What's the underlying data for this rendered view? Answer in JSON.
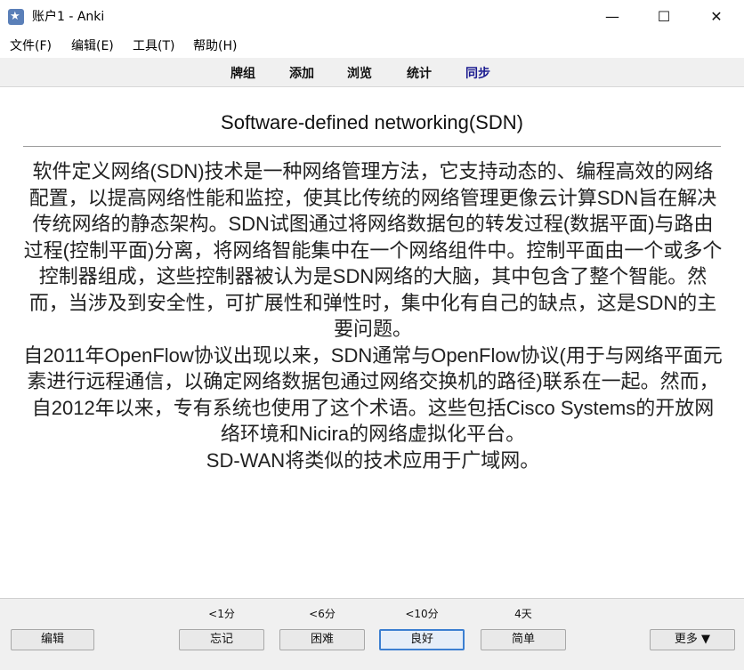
{
  "window": {
    "title": "账户1 - Anki",
    "minimize_glyph": "—",
    "maximize_glyph": "☐",
    "close_glyph": "✕",
    "icon": "anki-star-icon"
  },
  "menu": [
    {
      "label": "文件(F)"
    },
    {
      "label": "编辑(E)"
    },
    {
      "label": "工具(T)"
    },
    {
      "label": "帮助(H)"
    }
  ],
  "toolbar": {
    "decks": "牌组",
    "add": "添加",
    "browse": "浏览",
    "stats": "统计",
    "sync": "同步"
  },
  "card": {
    "title": "Software-defined networking(SDN)",
    "paragraph1": "软件定义网络(SDN)技术是一种网络管理方法，它支持动态的、编程高效的网络配置，以提高网络性能和监控，使其比传统的网络管理更像云计算SDN旨在解决传统网络的静态架构。SDN试图通过将网络数据包的转发过程(数据平面)与路由过程(控制平面)分离，将网络智能集中在一个网络组件中。控制平面由一个或多个控制器组成，这些控制器被认为是SDN网络的大脑，其中包含了整个智能。然而，当涉及到安全性，可扩展性和弹性时，集中化有自己的缺点，这是SDN的主要问题。",
    "paragraph2": "自2011年OpenFlow协议出现以来，SDN通常与OpenFlow协议(用于与网络平面元素进行远程通信，以确定网络数据包通过网络交换机的路径)联系在一起。然而，自2012年以来，专有系统也使用了这个术语。这些包括Cisco Systems的开放网络环境和Nicira的网络虚拟化平台。",
    "paragraph3": "SD-WAN将类似的技术应用于广域网。"
  },
  "bottom": {
    "edit_label": "编辑",
    "more_label": "更多 ▼",
    "answers": [
      {
        "due": "<1分",
        "label": "忘记"
      },
      {
        "due": "<6分",
        "label": "困难"
      },
      {
        "due": "<10分",
        "label": "良好"
      },
      {
        "due": "4天",
        "label": "简单"
      }
    ]
  },
  "colors": {
    "toolbar_bg": "#f0f0f0",
    "sync_link": "#1a1a8f",
    "default_button_border": "#3c7fd1"
  }
}
